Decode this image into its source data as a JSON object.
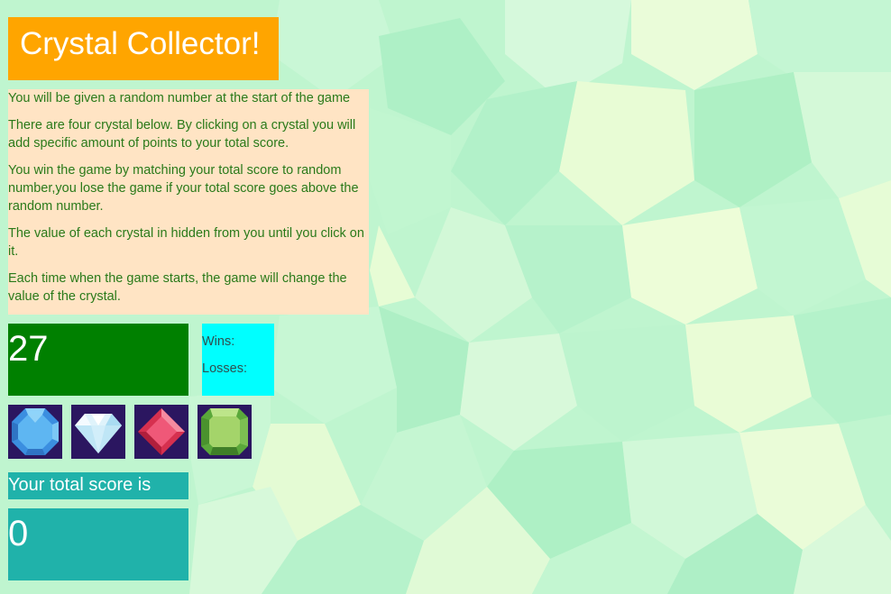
{
  "header": {
    "title": "Crystal Collector!"
  },
  "instructions": [
    "You will be given a random number at the start of the game",
    "There are four crystal below. By clicking on a crystal you will add specific amount of points to your total score.",
    "You win the game by matching your total score to random number,you lose the game if your total score goes above the random number.",
    "The value of each crystal in hidden from you until you click on it.",
    "Each time when the game starts, the game will change the value of the crystal."
  ],
  "game": {
    "target_number": "27",
    "wins_label": "Wins:",
    "losses_label": "Losses:",
    "score_label": "Your total score is",
    "total_score": "0"
  },
  "crystals": [
    {
      "icon": "blue-octagon-crystal-icon"
    },
    {
      "icon": "white-diamond-crystal-icon"
    },
    {
      "icon": "red-square-crystal-icon"
    },
    {
      "icon": "green-square-crystal-icon"
    }
  ],
  "colors": {
    "title_bg": "#ffa500",
    "instructions_bg": "#ffe4c4",
    "instructions_text": "#2a7a1a",
    "target_bg": "#008000",
    "record_bg": "#00ffff",
    "crystal_bg": "#2b1660",
    "score_bg": "#20b2aa",
    "page_bg": "#bff5cf"
  }
}
